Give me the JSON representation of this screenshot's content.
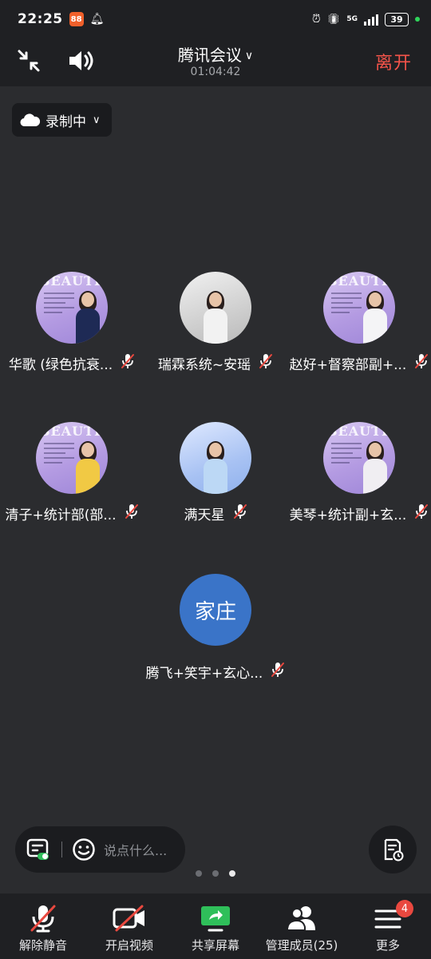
{
  "status_bar": {
    "time": "22:25",
    "app_icon_text": "88",
    "network": "5G",
    "battery": "39"
  },
  "header": {
    "title": "腾讯会议",
    "timer": "01:04:42",
    "leave_label": "离开"
  },
  "recording": {
    "label": "录制中"
  },
  "participants": [
    {
      "name": "华歌 (绿色抗衰...",
      "avatar_style": "purple",
      "avatar_word": "BEAUTIF",
      "muted": true
    },
    {
      "name": "瑞霖系统~安瑶",
      "avatar_style": "gray",
      "avatar_word": "",
      "muted": true
    },
    {
      "name": "赵好+督察部副+...",
      "avatar_style": "purple",
      "avatar_word": "BEAUTIF",
      "muted": true
    },
    {
      "name": "清子+统计部(部...",
      "avatar_style": "purple",
      "avatar_word": "BEAUTIF",
      "muted": true
    },
    {
      "name": "满天星",
      "avatar_style": "blue",
      "avatar_word": "",
      "muted": true
    },
    {
      "name": "美琴+统计副+玄...",
      "avatar_style": "purple",
      "avatar_word": "BEAUTIF",
      "muted": true
    },
    {
      "name": "腾飞+笑宇+玄心...",
      "avatar_style": "text",
      "avatar_text": "家庄",
      "muted": true
    }
  ],
  "chat": {
    "placeholder": "说点什么..."
  },
  "pager": {
    "pages": 3,
    "active": 3
  },
  "toolbar": {
    "unmute_label": "解除静音",
    "video_label": "开启视频",
    "share_label": "共享屏幕",
    "members_label": "管理成员(25)",
    "more_label": "更多",
    "more_badge": "4"
  },
  "colors": {
    "leave": "#f5544a",
    "share_accent": "#2fbf5a",
    "badge": "#e9483f",
    "avatar_text_bg": "#3a74c8"
  }
}
